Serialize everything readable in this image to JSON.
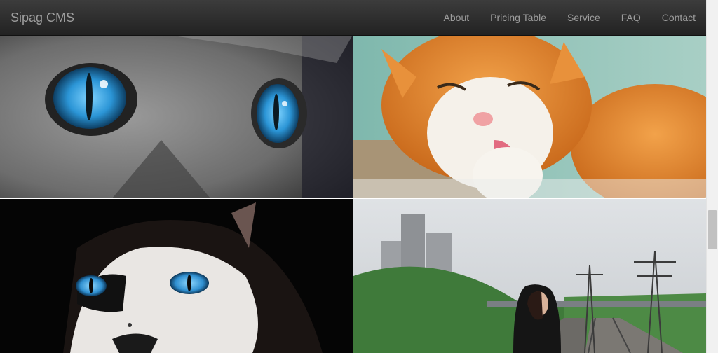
{
  "navbar": {
    "brand": "Sipag CMS",
    "items": [
      {
        "label": "About"
      },
      {
        "label": "Pricing Table"
      },
      {
        "label": "Service"
      },
      {
        "label": "FAQ"
      },
      {
        "label": "Contact"
      }
    ]
  },
  "gallery": {
    "images": [
      {
        "subject": "grey cat with blue eyes close-up"
      },
      {
        "subject": "orange and white cat licking"
      },
      {
        "subject": "black and white cat with blue eyes"
      },
      {
        "subject": "woman in black hoodie on railway tracks"
      }
    ]
  },
  "scrollbar": {
    "position_fraction": 0.67
  },
  "colors": {
    "navbar_bg": "#2a2a2a",
    "nav_text": "#9d9d9d",
    "eye_blue": "#3aa6e0"
  }
}
